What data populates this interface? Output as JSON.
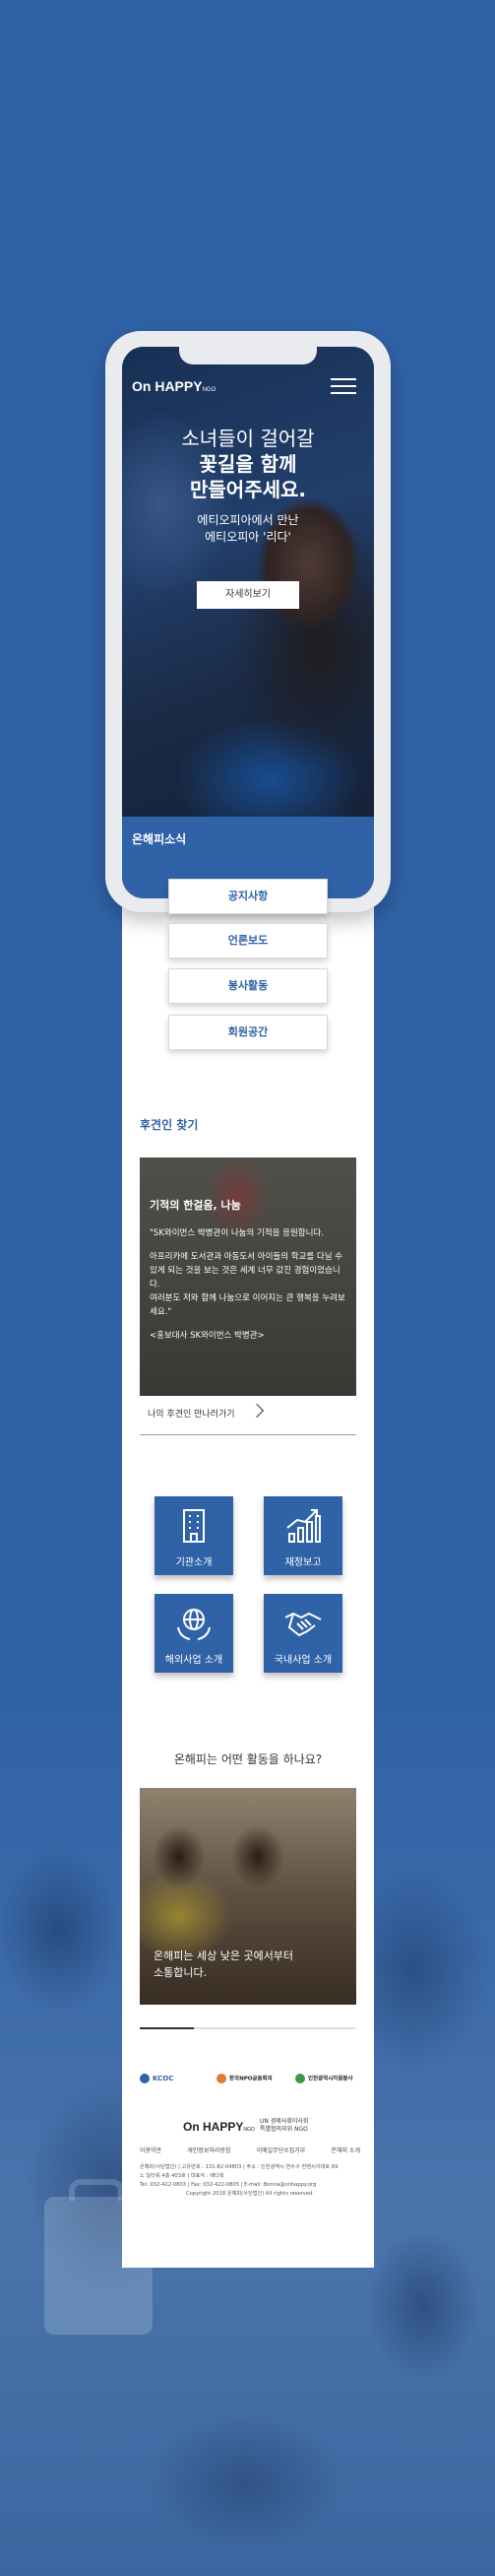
{
  "brand": {
    "logo_main": "On HAPPY",
    "logo_sub": "NGO"
  },
  "hero": {
    "title_line1": "소녀들이 걸어갈",
    "title_line2": "꽃길을 함께",
    "title_line3": "만들어주세요.",
    "sub_line1": "에티오피아에서 만난",
    "sub_line2": "에티오피아 '리다'",
    "button_label": "자세히보기"
  },
  "news": {
    "section_title": "온해피소식",
    "buttons": [
      "공지사항",
      "언론보도",
      "봉사활동",
      "회원공간"
    ]
  },
  "sponsor": {
    "section_title": "후견인 찾기",
    "card_heading": "기적의 한걸음, 나눔",
    "card_body": [
      "\"SK와이번스 박병관이 나눔의 기적을 응원합니다.",
      "아프리카에 도서관과 아동도서 아이들의 학교를 다닐 수 있게 되는 것을 보는 것은 세계 너무 값진 경험이었습니다.",
      "여러분도 저와 함께 나눔으로 이어지는 큰 행복을 누려보세요.\"",
      "<홍보대사 SK와이번스 박병관>"
    ],
    "link_label": "나의 후견인 만나러가기"
  },
  "tiles": [
    {
      "label": "기관소개",
      "icon": "building-icon"
    },
    {
      "label": "재정보고",
      "icon": "growth-chart-icon"
    },
    {
      "label": "해외사업 소개",
      "icon": "globe-hands-icon"
    },
    {
      "label": "국내사업 소개",
      "icon": "handshake-icon"
    }
  ],
  "activity": {
    "question": "온해피는 어떤 활동을 하나요?",
    "card_line1": "온해피는 세상 낮은 곳에서부터",
    "card_line2": "소통합니다.",
    "progress": 0.25
  },
  "partners": [
    {
      "name": "KCOC",
      "color": "#2f62a6"
    },
    {
      "name": "한국NPO공동회의",
      "color": "#e27b2c"
    },
    {
      "name": "인천광역시자원봉사",
      "color": "#3a9a4a"
    }
  ],
  "footer": {
    "logo_main": "On HAPPY",
    "logo_sub": "NGO",
    "org_line1": "UN 경제사회이사회",
    "org_line2": "특별협의지위 NGO",
    "links": [
      "이용약관",
      "개인정보처리방침",
      "이메일무단수집거부",
      "온해피 소개"
    ],
    "info_line1": "온해피(사단법인) | 고유번호 : 131-82-04803 | 주소 : 인천광역시 연수구 컨벤시아대로 69",
    "info_line2": "노 일타워 4층 403호 | 대표자 : 배다희",
    "info_line3": "Tel: 032-422-0803 | Fax: 032-422-0805 | E-mail: Bonna@onhappy.org",
    "copyright": "Copyright 2018 온해피(사단법인) All rights reserved."
  },
  "colors": {
    "brand_blue": "#2f62a6",
    "white": "#ffffff"
  }
}
